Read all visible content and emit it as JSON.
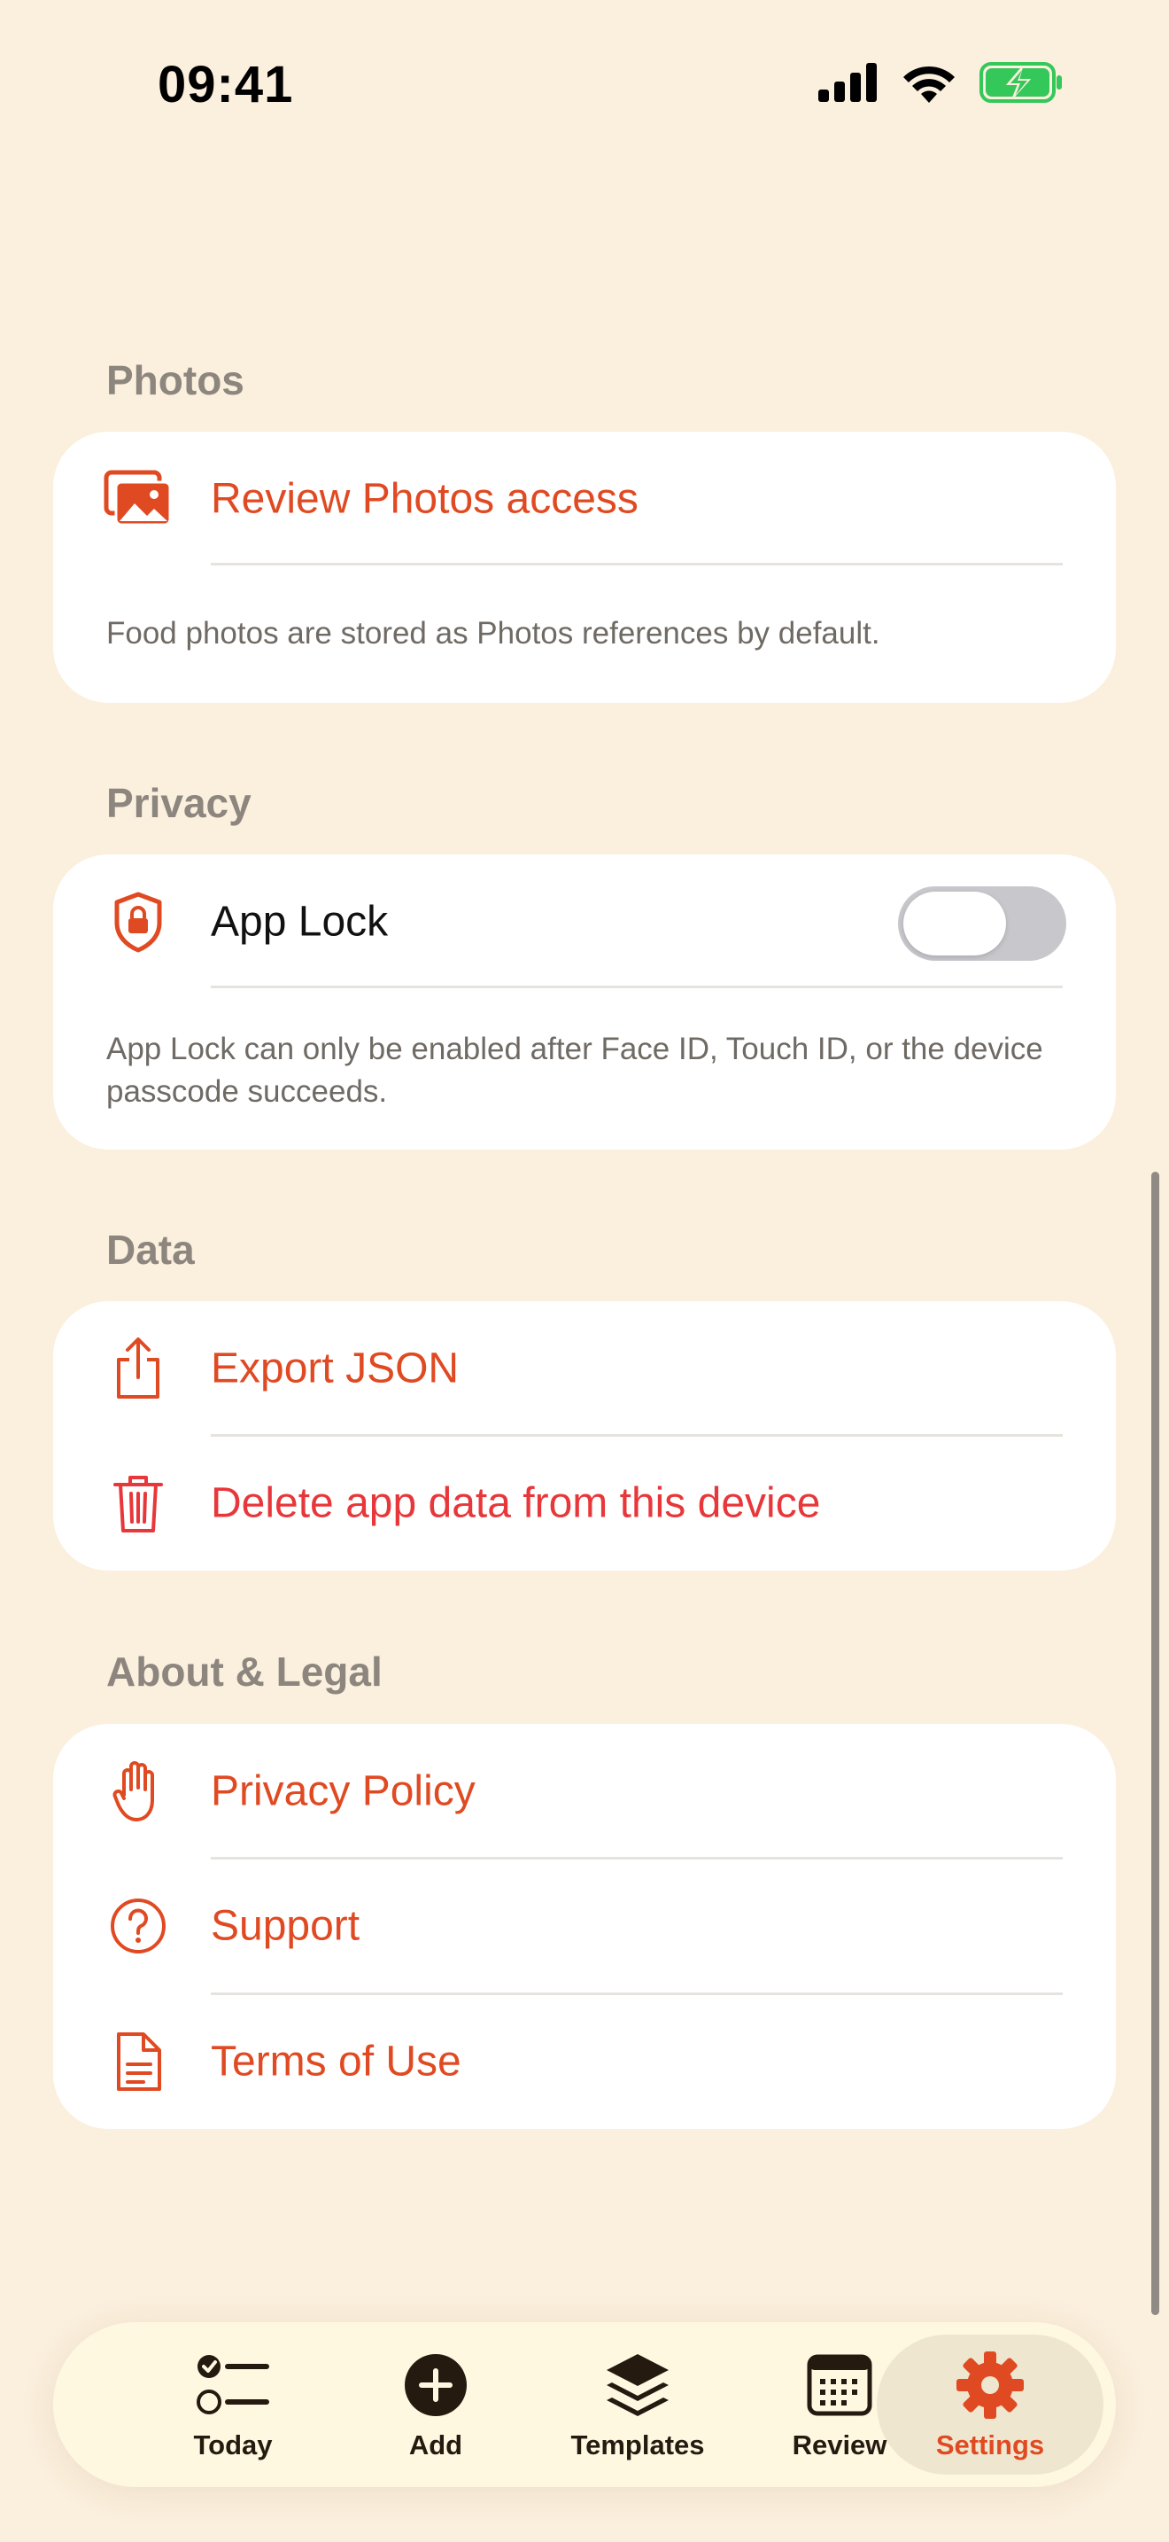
{
  "status_bar": {
    "time": "09:41"
  },
  "sections": {
    "photos": {
      "title": "Photos",
      "review_label": "Review Photos access",
      "footnote": "Food photos are stored as Photos references by default."
    },
    "privacy": {
      "title": "Privacy",
      "app_lock_label": "App Lock",
      "app_lock_enabled": false,
      "footnote": "App Lock can only be enabled after Face ID, Touch ID, or the device passcode succeeds."
    },
    "data": {
      "title": "Data",
      "export_label": "Export JSON",
      "delete_label": "Delete app data from this device"
    },
    "about": {
      "title": "About & Legal",
      "privacy_policy_label": "Privacy Policy",
      "support_label": "Support",
      "terms_label": "Terms of Use"
    }
  },
  "tabbar": {
    "tabs": [
      {
        "label": "Today",
        "icon": "checklist-icon"
      },
      {
        "label": "Add",
        "icon": "plus-circle-icon"
      },
      {
        "label": "Templates",
        "icon": "layers-icon"
      },
      {
        "label": "Review",
        "icon": "calendar-icon"
      },
      {
        "label": "Settings",
        "icon": "gear-icon"
      }
    ],
    "selected": "Settings"
  },
  "colors": {
    "background": "#FBEFDD",
    "accent": "#E04A22",
    "destructive": "#E8373A",
    "section_title": "#8C867E",
    "battery_green": "#34C759"
  }
}
